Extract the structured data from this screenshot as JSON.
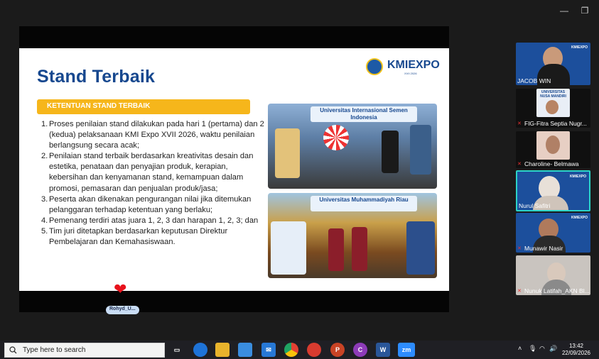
{
  "slide": {
    "title": "Stand Terbaik",
    "logo_text": "KMIEXPO",
    "logo_sub": "XVII 2026",
    "banner": "KETENTUAN STAND TERBAIK",
    "rules": [
      {
        "num": "1.",
        "text": "Proses penilaian stand dilakukan pada hari 1 (pertama) dan 2 (kedua) pelaksanaan KMI Expo XVII 2026, waktu penilaian berlangsung secara acak;"
      },
      {
        "num": "2.",
        "text": "Penilaian stand terbaik berdasarkan kreativitas desain dan estetika, penataan dan penyajian produk, kerapian, kebersihan dan kenyamanan stand, kemampuan dalam promosi, pemasaran dan penjualan produk/jasa;"
      },
      {
        "num": "3.",
        "text": "Peserta akan dikenakan pengurangan nilai jika ditemukan pelanggaran terhadap ketentuan yang berlaku;"
      },
      {
        "num": "4.",
        "text": "Pemenang terdiri atas juara 1, 2, 3 dan harapan 1, 2, 3; dan"
      },
      {
        "num": "5.",
        "text": "Tim juri ditetapkan berdasarkan keputusan Direktur Pembelajaran dan Kemahasiswaan."
      }
    ],
    "photo1_caption": "Universitas Internasional Semen Indonesia",
    "photo2_caption": "Universitas Muhammadiyah Riau",
    "name_tag": "Rohyd_U...",
    "heart": "❤"
  },
  "participants": [
    {
      "name": "JACOB WIN",
      "bg": "#1c4f9c"
    },
    {
      "name": "FIG-Fitra Septia Nugr...",
      "bg": "#101010"
    },
    {
      "name": "Charoline- Belmawa",
      "bg": "#101010"
    },
    {
      "name": "Nurul Safitri",
      "bg": "#1c4f9c",
      "active": true
    },
    {
      "name": "Munawir Nasir",
      "bg": "#1c4f9c"
    },
    {
      "name": "Nunuk Latifah_AKN Bl...",
      "bg": "#c9c4bf"
    }
  ],
  "participant_logo": "KMIEXPO",
  "fig_tile_text": "UNIVERSITAS NUSA MANDIRI",
  "taskbar": {
    "search_placeholder": "Type here to search",
    "apps": [
      {
        "label": "zm",
        "color": "#2d8cff"
      }
    ],
    "time": "13:42",
    "date": "22/09/2026",
    "tray_icons": [
      "chevron-up-icon",
      "microphone-icon",
      "wifi-icon",
      "speaker-icon"
    ]
  },
  "colors": {
    "title_blue": "#17488f",
    "banner_yellow": "#f6b61b",
    "active_border": "#2bd4c8"
  }
}
